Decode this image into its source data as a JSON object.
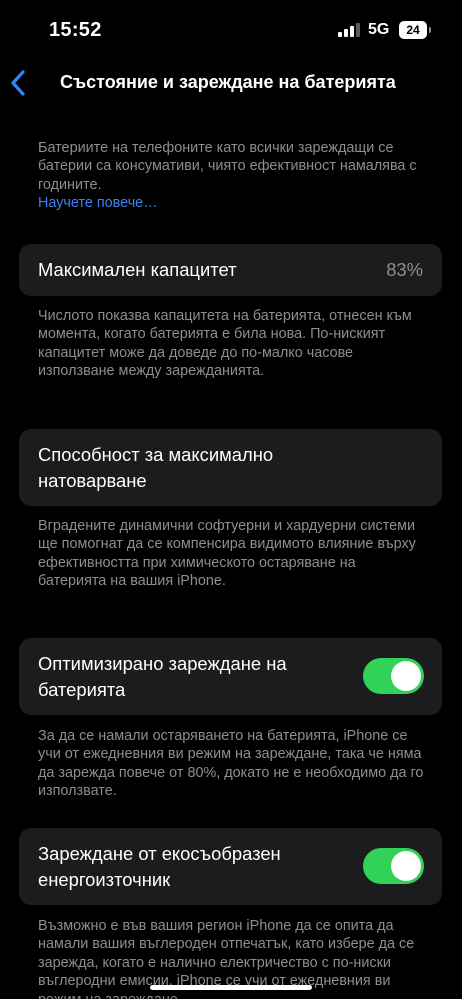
{
  "status_bar": {
    "time": "15:52",
    "network": "5G",
    "battery_level": "24"
  },
  "nav": {
    "back_icon": "chevron-left-icon",
    "title": "Състояние и зареждане на батерията"
  },
  "intro": {
    "text": "Батериите на телефоните като всички зареждащи се батерии са консумативи, чиято ефективност намалява с годините.",
    "link": "Научете повече…"
  },
  "max_capacity": {
    "label": "Максимален капацитет",
    "value": "83%",
    "footer": "Числото показва капацитета на батерията, отнесен към момента, когато батерията е била нова. По-ниският капацитет може да доведе до по-малко часове използване между зарежданията."
  },
  "peak_performance": {
    "label": "Способност за максимално натоварване",
    "footer": "Вградените динамични софтуерни и хардуерни системи ще помогнат да се компенсира видимото влияние върху ефективността при химическото остаряване на батерията на вашия iPhone."
  },
  "optimized_charging": {
    "label": "Оптимизирано зареждане на батерията",
    "enabled": true,
    "footer": "За да се намали остаряването на батерията, iPhone се учи от ежедневния ви режим на зареждане, така че няма да зарежда повече от 80%, докато не е необходимо да го използвате."
  },
  "clean_energy": {
    "label": "Зареждане от екосъобразен енергоизточник",
    "enabled": true,
    "footer": "Възможно е във вашия регион iPhone да се опита да намали вашия въглероден отпечатък, като избере да се зарежда, когато е налично електричество с по-ниски въглеродни емисии. iPhone се учи от ежедневния ви режим на зареждане"
  },
  "colors": {
    "background": "#000000",
    "card": "#1c1c1e",
    "secondary_text": "#8d8d92",
    "link": "#3b82f6",
    "toggle_on": "#32d158",
    "back_chevron": "#2f86f6"
  }
}
